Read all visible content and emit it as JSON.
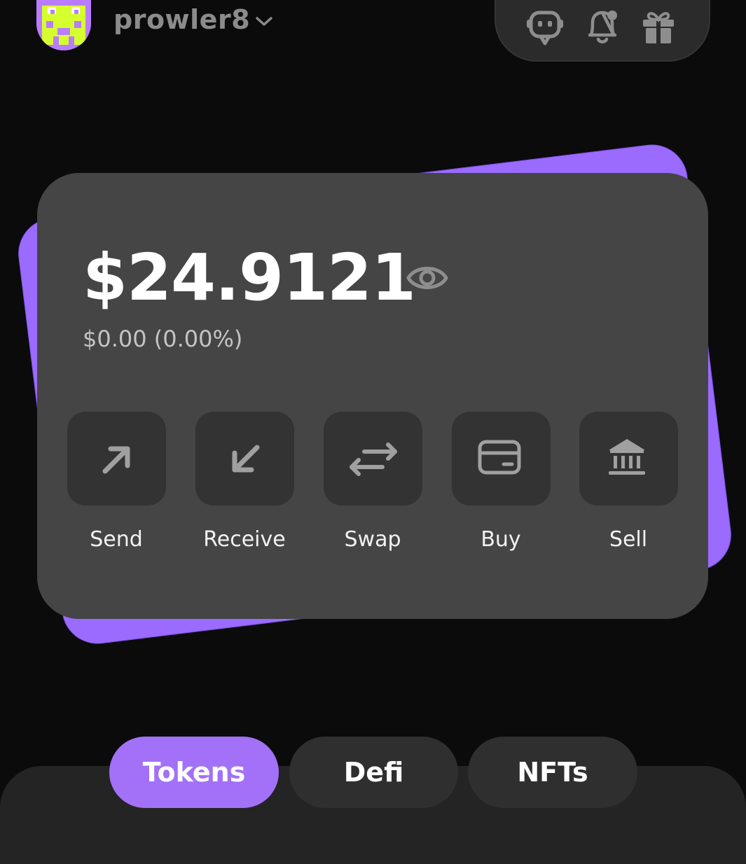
{
  "header": {
    "username": "prowler8",
    "icons": [
      "bot-icon",
      "bell-icon",
      "gift-icon"
    ]
  },
  "wallet": {
    "balance": "$24.9121",
    "change": "$0.00 (0.00%)"
  },
  "actions": [
    {
      "label": "Send",
      "icon": "arrow-up-right-icon"
    },
    {
      "label": "Receive",
      "icon": "arrow-down-left-icon"
    },
    {
      "label": "Swap",
      "icon": "swap-arrows-icon"
    },
    {
      "label": "Buy",
      "icon": "credit-card-icon"
    },
    {
      "label": "Sell",
      "icon": "bank-icon"
    }
  ],
  "tabs": [
    {
      "label": "Tokens",
      "active": true
    },
    {
      "label": "Defi",
      "active": false
    },
    {
      "label": "NFTs",
      "active": false
    }
  ],
  "colors": {
    "accent": "#a371f7",
    "background": "#0b0b0b",
    "card": "#454545",
    "action_button": "#333333"
  }
}
